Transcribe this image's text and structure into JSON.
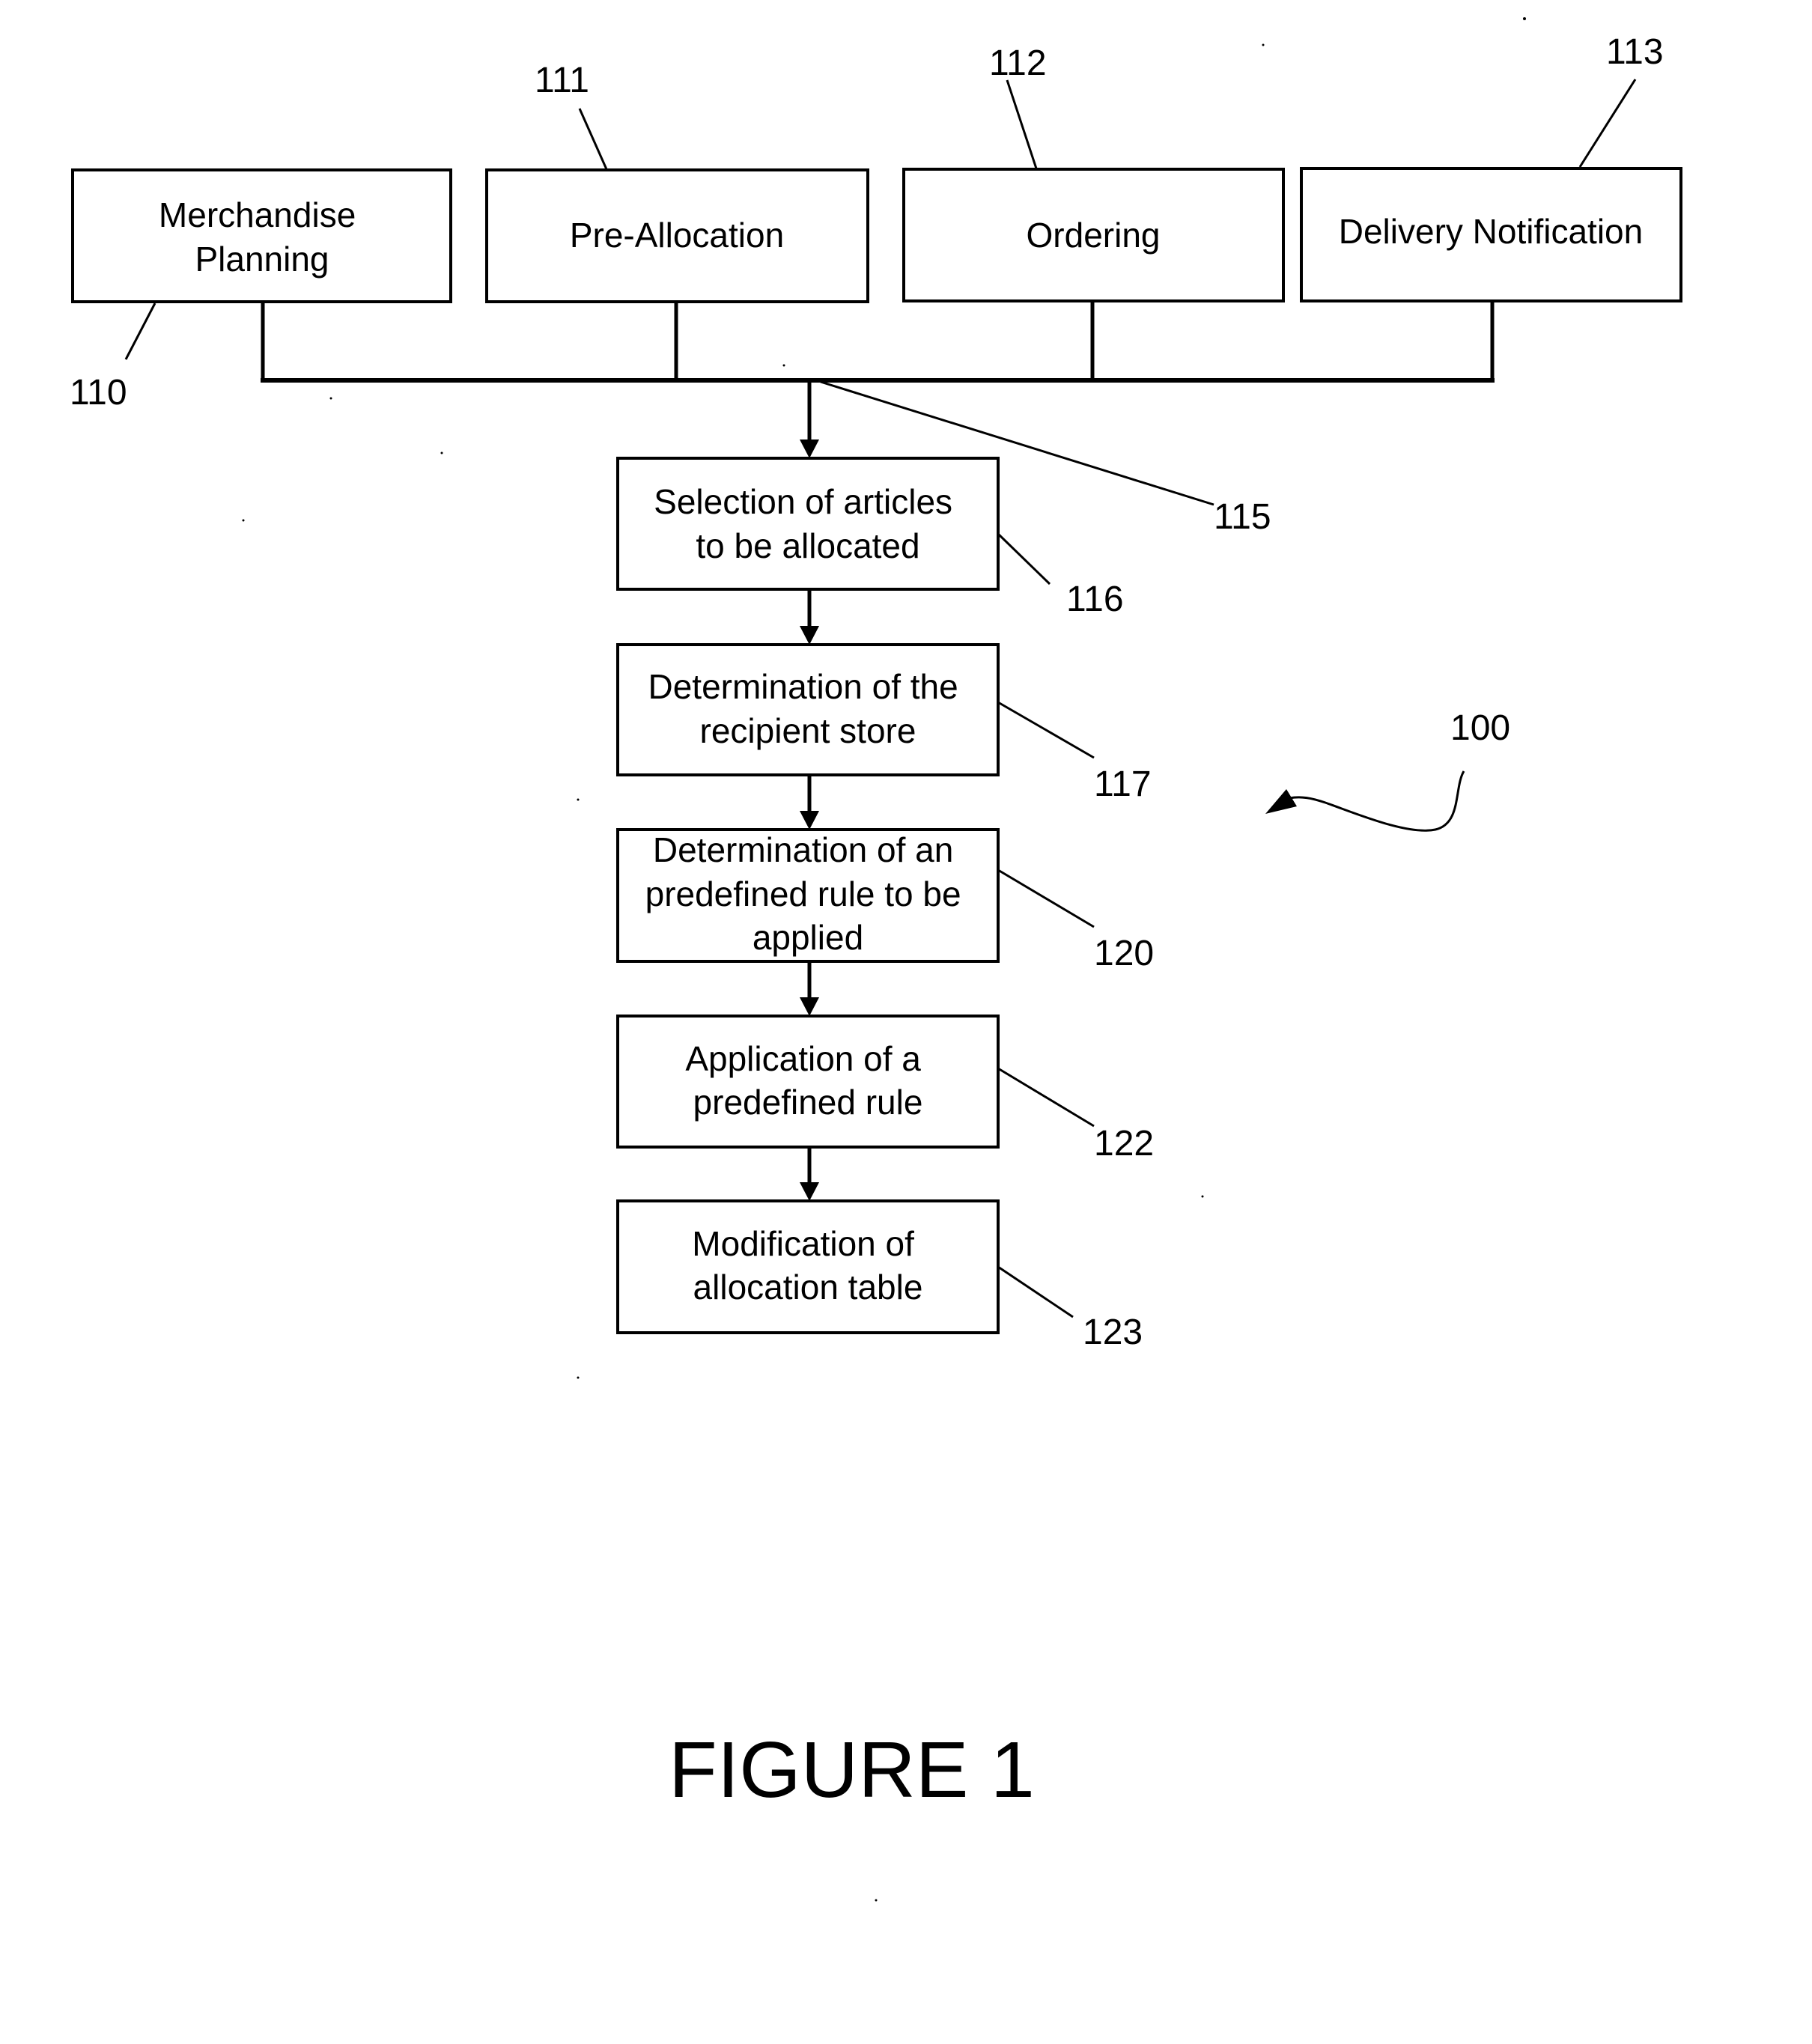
{
  "figure": {
    "caption": "FIGURE 1",
    "overall_ref": "100"
  },
  "source_boxes": [
    {
      "ref": "110",
      "lines": [
        "Merchandise",
        "Planning"
      ]
    },
    {
      "ref": "111",
      "lines": [
        "Pre-Allocation"
      ]
    },
    {
      "ref": "112",
      "lines": [
        "Ordering"
      ]
    },
    {
      "ref": "113",
      "lines": [
        "Delivery Notification"
      ]
    }
  ],
  "bus_ref": "115",
  "flow_steps": [
    {
      "ref": "116",
      "lines": [
        "Selection of articles",
        "to be allocated"
      ]
    },
    {
      "ref": "117",
      "lines": [
        "Determination of the",
        "recipient store"
      ]
    },
    {
      "ref": "120",
      "lines": [
        "Determination of an",
        "predefined rule to be",
        "applied"
      ]
    },
    {
      "ref": "122",
      "lines": [
        "Application of a",
        "predefined rule"
      ]
    },
    {
      "ref": "123",
      "lines": [
        "Modification of",
        "allocation table"
      ]
    }
  ],
  "colors": {
    "ink": "#000000",
    "paper": "#ffffff"
  }
}
